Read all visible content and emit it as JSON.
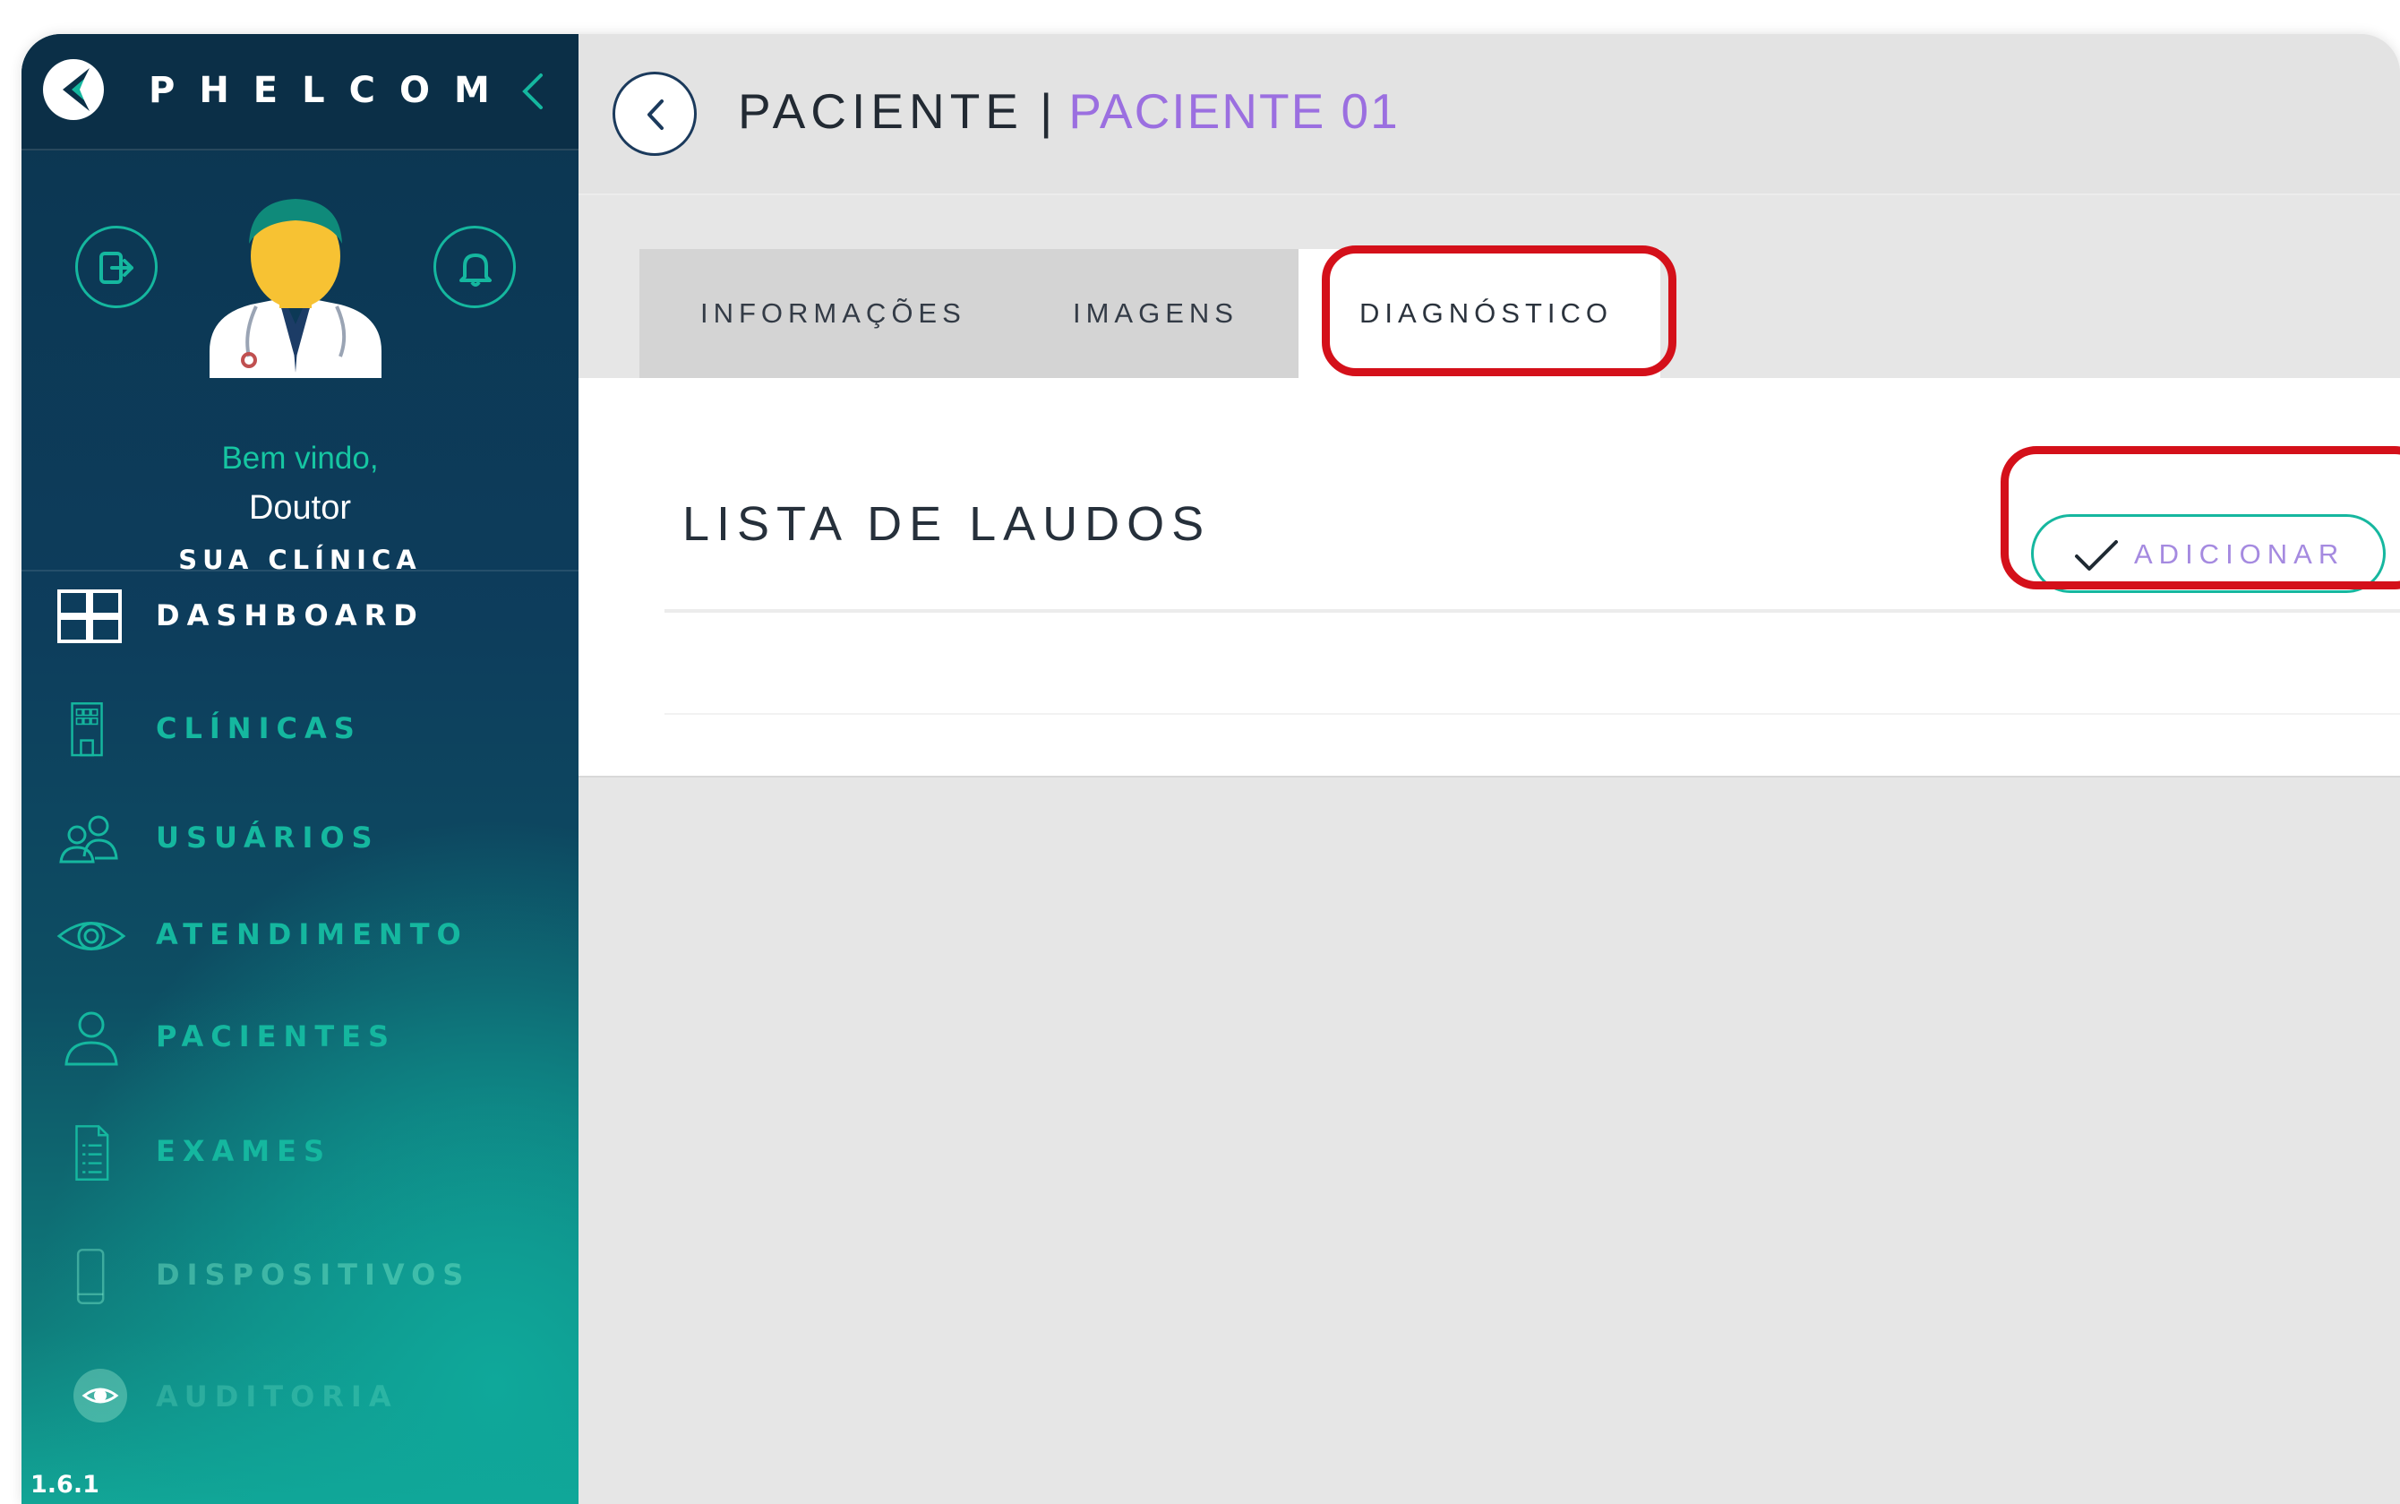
{
  "app": {
    "brand": "PHELCOM",
    "version": "1.6.1"
  },
  "sidebar": {
    "welcome": "Bem vindo,",
    "user_name": "Doutor",
    "clinic": "SUA CLÍNICA",
    "items": [
      {
        "label": "DASHBOARD",
        "icon": "dashboard-icon",
        "state": "active"
      },
      {
        "label": "CLÍNICAS",
        "icon": "building-icon",
        "state": "normal"
      },
      {
        "label": "USUÁRIOS",
        "icon": "users-icon",
        "state": "normal"
      },
      {
        "label": "ATENDIMENTO",
        "icon": "eye-icon",
        "state": "normal"
      },
      {
        "label": "PACIENTES",
        "icon": "user-icon",
        "state": "normal"
      },
      {
        "label": "EXAMES",
        "icon": "document-icon",
        "state": "normal"
      },
      {
        "label": "DISPOSITIVOS",
        "icon": "device-icon",
        "state": "faded"
      },
      {
        "label": "AUDITORIA",
        "icon": "eye-filled-icon",
        "state": "faded"
      }
    ]
  },
  "header": {
    "title": "PACIENTE",
    "separator": "|",
    "patient": "PACIENTE 01"
  },
  "tabs": [
    {
      "label": "INFORMAÇÕES",
      "active": false
    },
    {
      "label": "IMAGENS",
      "active": false
    },
    {
      "label": "DIAGNÓSTICO",
      "active": true
    }
  ],
  "panel": {
    "title": "LISTA DE LAUDOS",
    "add_button": "ADICIONAR"
  },
  "colors": {
    "accent_teal": "#16b79f",
    "accent_purple": "#9b6fe0",
    "highlight_red": "#d4101a",
    "sidebar_dark": "#0c3550"
  }
}
